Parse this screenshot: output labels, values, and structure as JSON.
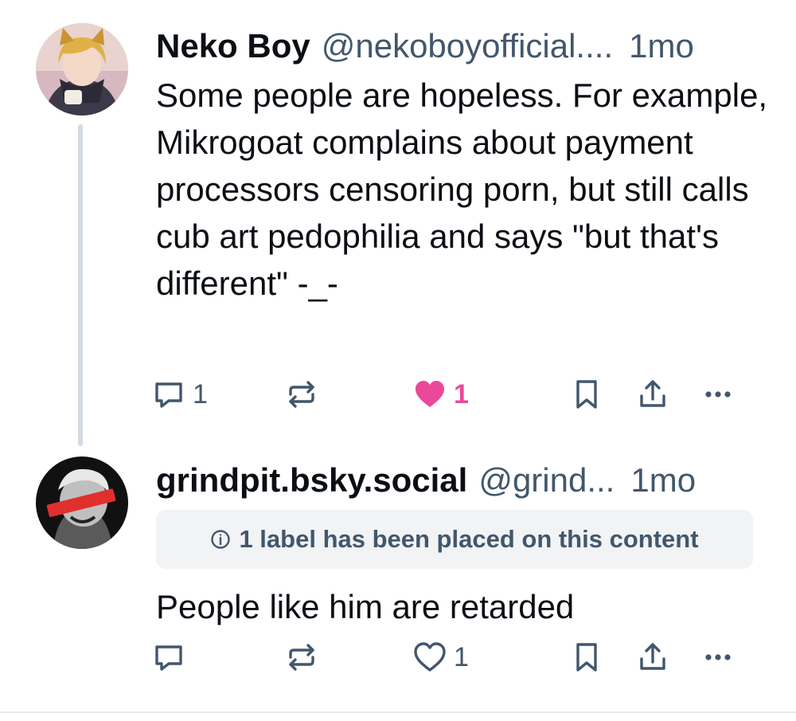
{
  "posts": [
    {
      "author": "Neko Boy",
      "handle": "@nekoboyofficial....",
      "time": "1mo",
      "text": "Some people are hopeless. For example, Mikrogoat complains about payment processors censoring porn, but still calls cub art pedophilia and says \"but that's different\" -_-",
      "reply_count": "1",
      "like_count": "1",
      "liked": true
    },
    {
      "author": "grindpit.bsky.social",
      "handle": "@grind...",
      "time": "1mo",
      "label_notice": "1 label has been placed on this content",
      "text": "People like him are retarded",
      "like_count": "1",
      "liked": false
    }
  ],
  "colors": {
    "muted": "#42576c",
    "like_active": "#ec4899",
    "thread_line": "#d4dbe2",
    "label_bg": "#f1f3f5"
  },
  "icons": [
    "reply-icon",
    "repost-icon",
    "heart-icon",
    "bookmark-icon",
    "share-icon",
    "more-icon",
    "info-icon"
  ]
}
